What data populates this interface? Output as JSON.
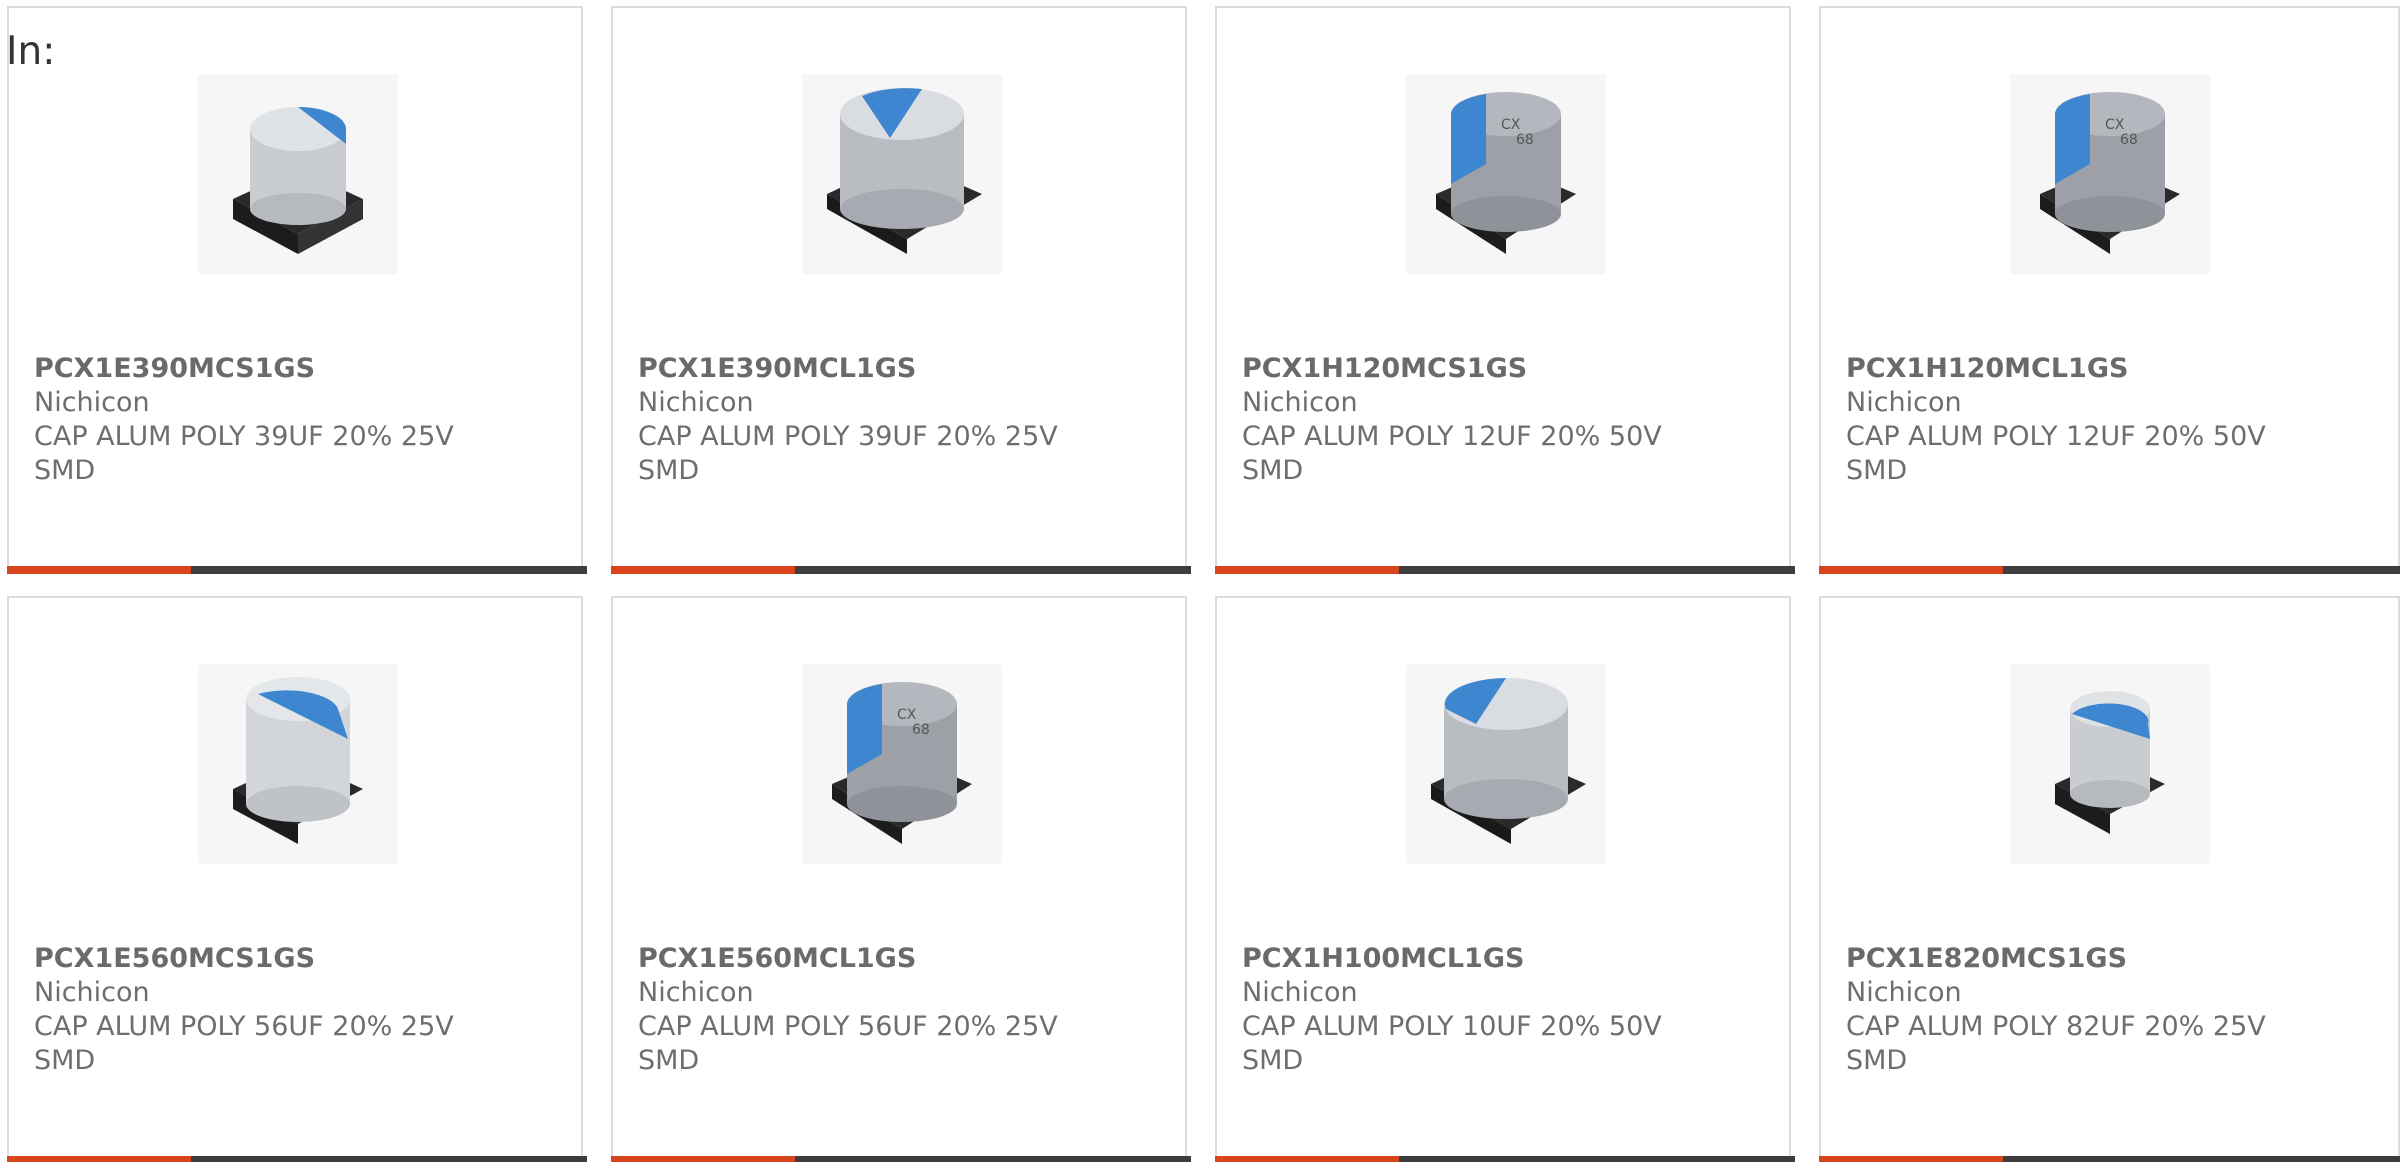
{
  "header": {
    "label": "In:"
  },
  "colors": {
    "accent_bar": "#d9441c",
    "dark_bar": "#3d3d3d",
    "sleeve_blue": "#3f86d0"
  },
  "products": [
    {
      "part": "PCX1E390MCS1GS",
      "manufacturer": "Nichicon",
      "desc_line1": "CAP ALUM POLY 39UF 20% 25V",
      "desc_line2": "SMD",
      "image_icon": "capacitor-icon"
    },
    {
      "part": "PCX1E390MCL1GS",
      "manufacturer": "Nichicon",
      "desc_line1": "CAP ALUM POLY 39UF 20% 25V",
      "desc_line2": "SMD",
      "image_icon": "capacitor-icon"
    },
    {
      "part": "PCX1H120MCS1GS",
      "manufacturer": "Nichicon",
      "desc_line1": "CAP ALUM POLY 12UF 20% 50V",
      "desc_line2": "SMD",
      "image_icon": "capacitor-icon"
    },
    {
      "part": "PCX1H120MCL1GS",
      "manufacturer": "Nichicon",
      "desc_line1": "CAP ALUM POLY 12UF 20% 50V",
      "desc_line2": "SMD",
      "image_icon": "capacitor-icon"
    },
    {
      "part": "PCX1E560MCS1GS",
      "manufacturer": "Nichicon",
      "desc_line1": "CAP ALUM POLY 56UF 20% 25V",
      "desc_line2": "SMD",
      "image_icon": "capacitor-icon"
    },
    {
      "part": "PCX1E560MCL1GS",
      "manufacturer": "Nichicon",
      "desc_line1": "CAP ALUM POLY 56UF 20% 25V",
      "desc_line2": "SMD",
      "image_icon": "capacitor-icon"
    },
    {
      "part": "PCX1H100MCL1GS",
      "manufacturer": "Nichicon",
      "desc_line1": "CAP ALUM POLY 10UF 20% 50V",
      "desc_line2": "SMD",
      "image_icon": "capacitor-icon"
    },
    {
      "part": "PCX1E820MCS1GS",
      "manufacturer": "Nichicon",
      "desc_line1": "CAP ALUM POLY 82UF 20% 25V",
      "desc_line2": "SMD",
      "image_icon": "capacitor-icon"
    }
  ]
}
